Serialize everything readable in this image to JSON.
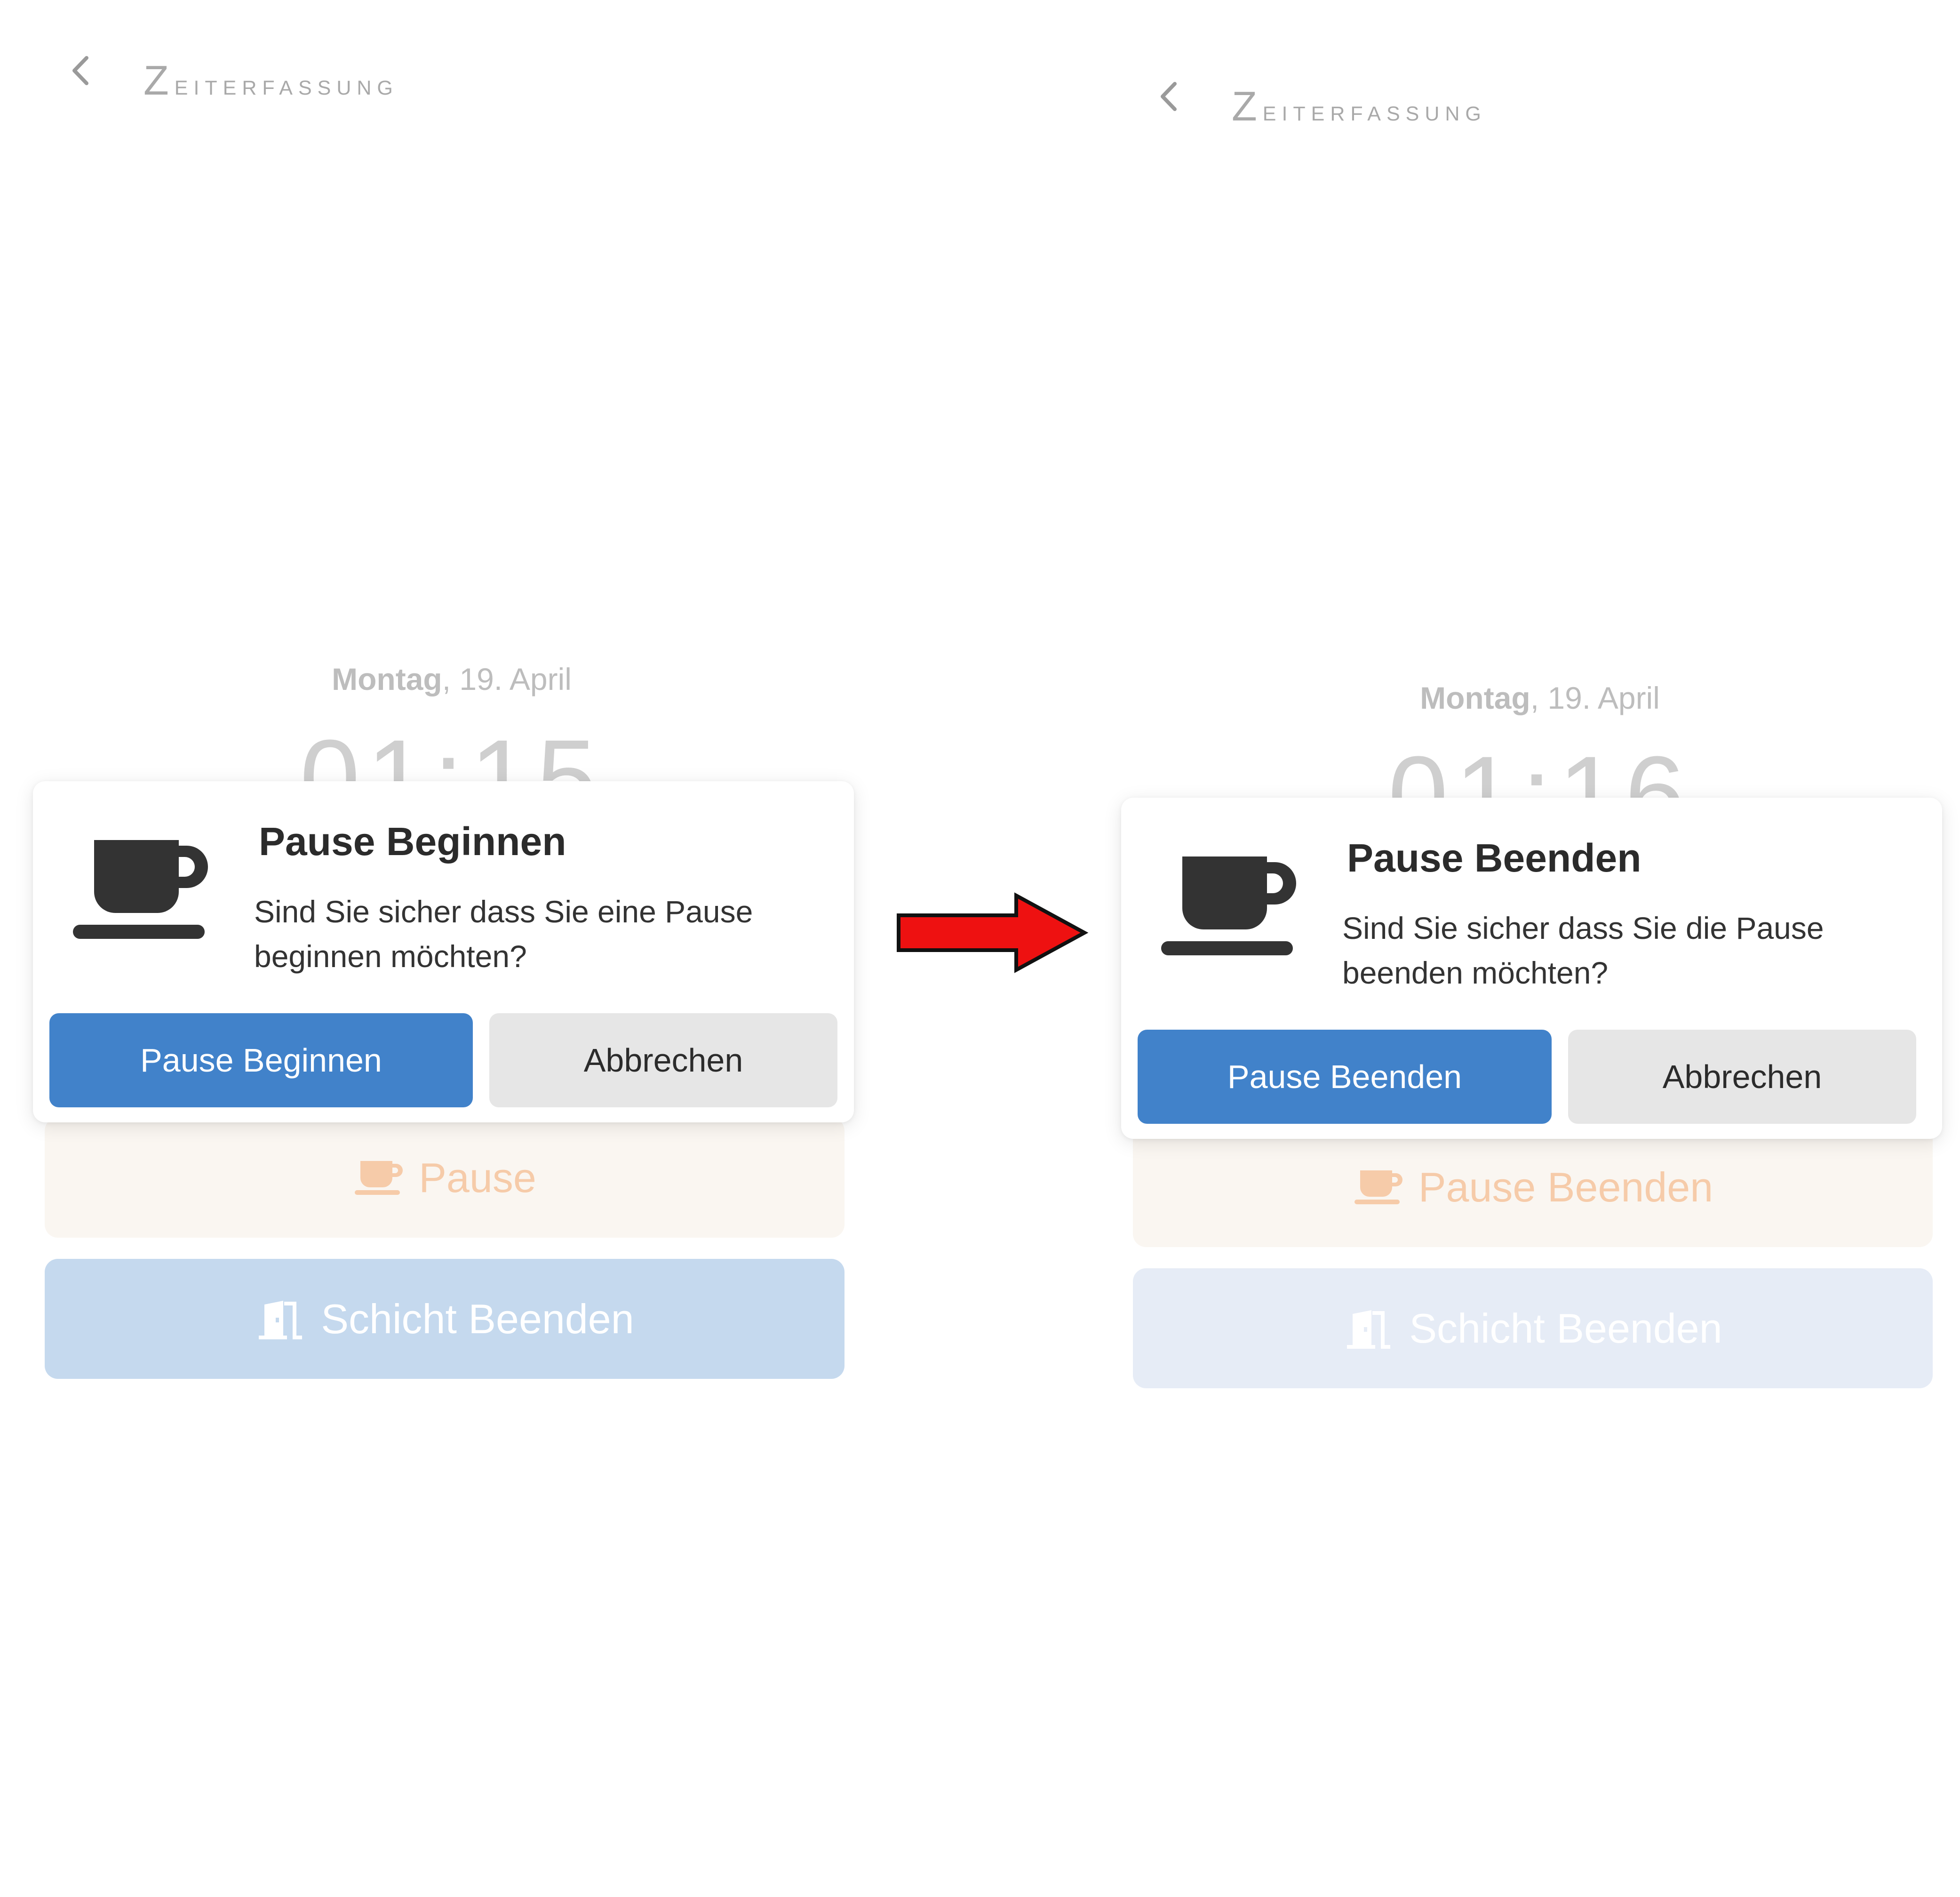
{
  "colors": {
    "primary_blue": "#4182ca",
    "cancel_gray": "#e6e6e6",
    "pause_text_faded": "#f6cba9",
    "arrow_red": "#ee1111",
    "icon_dark": "#333333"
  },
  "screens": [
    {
      "header": {
        "title_first": "Z",
        "title_rest": "eiterfassung",
        "back_icon": "chevron-left-icon"
      },
      "date": {
        "weekday": "Montag",
        "rest": ", 19. April"
      },
      "clock": "01:15",
      "background_buttons": {
        "pause_label": "Pause",
        "shift_label": "Schicht Beenden"
      },
      "dialog": {
        "icon": "coffee-cup-icon",
        "title": "Pause Beginnen",
        "message": "Sind Sie sicher dass Sie eine Pause beginnen möchten?",
        "confirm_label": "Pause Beginnen",
        "cancel_label": "Abbrechen"
      }
    },
    {
      "header": {
        "title_first": "Z",
        "title_rest": "eiterfassung",
        "back_icon": "chevron-left-icon"
      },
      "date": {
        "weekday": "Montag",
        "rest": ", 19. April"
      },
      "clock": "01:16",
      "background_buttons": {
        "pause_label": "Pause Beenden",
        "shift_label": "Schicht Beenden"
      },
      "dialog": {
        "icon": "coffee-cup-icon",
        "title": "Pause Beenden",
        "message": "Sind Sie sicher dass Sie die Pause beenden möchten?",
        "confirm_label": "Pause Beenden",
        "cancel_label": "Abbrechen"
      }
    }
  ],
  "transition_icon": "right-arrow-icon"
}
